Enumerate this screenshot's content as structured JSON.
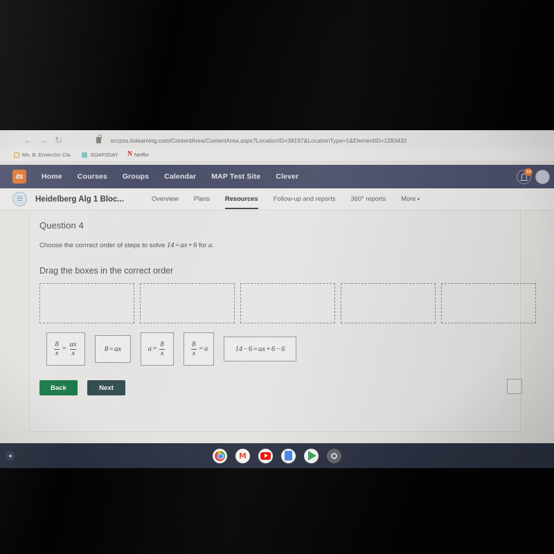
{
  "browser": {
    "url": "sccpss.itslearning.com/ContentArea/ContentArea.aspx?LocationID=38197&LocationType=1&ElementID=1283432",
    "back_glyph": "←",
    "forward_glyph": "→",
    "reload_glyph": "↻",
    "bookmarks": [
      {
        "label": "Ms. B. EnviroSci Cla..",
        "icon": "folder-icon"
      },
      {
        "label": "SOAP2DAY",
        "icon": "soap2day-icon"
      },
      {
        "label": "Netflix",
        "icon": "netflix-icon"
      }
    ]
  },
  "global_nav": {
    "logo_text": "its",
    "items": [
      {
        "label": "Home"
      },
      {
        "label": "Courses"
      },
      {
        "label": "Groups"
      },
      {
        "label": "Calendar"
      },
      {
        "label": "MAP Test Site"
      },
      {
        "label": "Clever"
      }
    ],
    "notification_badge": "18",
    "bell_icon": "bell-icon",
    "avatar_icon": "avatar"
  },
  "course_nav": {
    "course_icon": "course-icon",
    "title": "Heidelberg Alg 1 Bloc...",
    "items": [
      {
        "label": "Overview",
        "active": false
      },
      {
        "label": "Plans",
        "active": false
      },
      {
        "label": "Resources",
        "active": true
      },
      {
        "label": "Follow-up and reports",
        "active": false
      },
      {
        "label": "360° reports",
        "active": false
      }
    ],
    "more_label": "More",
    "more_caret": "▾"
  },
  "question": {
    "heading": "Question 4",
    "prompt_lead": "Choose the corrrect order of steps to solve",
    "prompt_equation": {
      "left": "14",
      "op": "=",
      "right_a": "ax",
      "plus": "+",
      "right_b": "6"
    },
    "prompt_tail": "for",
    "prompt_var": "a",
    "prompt_period": ".",
    "instruction": "Drag the boxes in the correct order",
    "dropzone_count": 5,
    "dropzones": [
      {
        "label": "",
        "filled": false
      },
      {
        "label": "",
        "filled": false
      },
      {
        "label": "",
        "filled": false
      },
      {
        "label": "",
        "filled": false
      },
      {
        "label": "",
        "filled": false
      }
    ],
    "tiles": [
      {
        "id": "tile-1",
        "text": "8/x = ax/x"
      },
      {
        "id": "tile-2",
        "text": "8 = ax"
      },
      {
        "id": "tile-3",
        "text": "a = 8/x"
      },
      {
        "id": "tile-4",
        "text": "8/x = a"
      },
      {
        "id": "tile-5",
        "text": "14 - 6 = ax + 6 - 6"
      }
    ]
  },
  "footer": {
    "back_label": "Back",
    "next_label": "Next"
  },
  "shelf": {
    "apps": [
      {
        "name": "chrome-app-icon"
      },
      {
        "name": "gmail-app-icon",
        "glyph": "M"
      },
      {
        "name": "youtube-app-icon"
      },
      {
        "name": "google-docs-app-icon"
      },
      {
        "name": "play-store-app-icon"
      },
      {
        "name": "settings-app-icon"
      }
    ],
    "status_tray_icon": "status-tray-icon"
  },
  "colors": {
    "nav_bg": "#474b68",
    "logo_orange": "#e8762c",
    "back_green": "#137a45",
    "next_teal": "#2d4a4d",
    "shelf_bg": "#242a3c",
    "page_bg": "#eceae6"
  }
}
